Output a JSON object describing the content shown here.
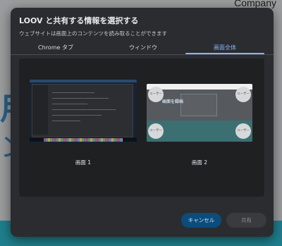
{
  "background": {
    "company": "Company",
    "glyph_1": "用",
    "glyph_2": "ン"
  },
  "dialog": {
    "title": "LOOV と共有する情報を選択する",
    "subtitle": "ウェブサイトは画面上のコンテンツを読み取ることができます",
    "tabs": [
      {
        "label": "Chrome タブ",
        "selected": false
      },
      {
        "label": "ウィンドウ",
        "selected": false
      },
      {
        "label": "画面全体",
        "selected": true
      }
    ],
    "screens": [
      {
        "label": "画面 1"
      },
      {
        "label": "画面 2",
        "thumb_title": "画面を録画",
        "circle_label": "ユーザー"
      }
    ],
    "buttons": {
      "cancel": "キャンセル",
      "share": "共有"
    }
  },
  "colors": {
    "accent": "#8ab4f8",
    "dialog_bg": "#2b2c2f",
    "cancel_bg": "#0b4c7c"
  }
}
